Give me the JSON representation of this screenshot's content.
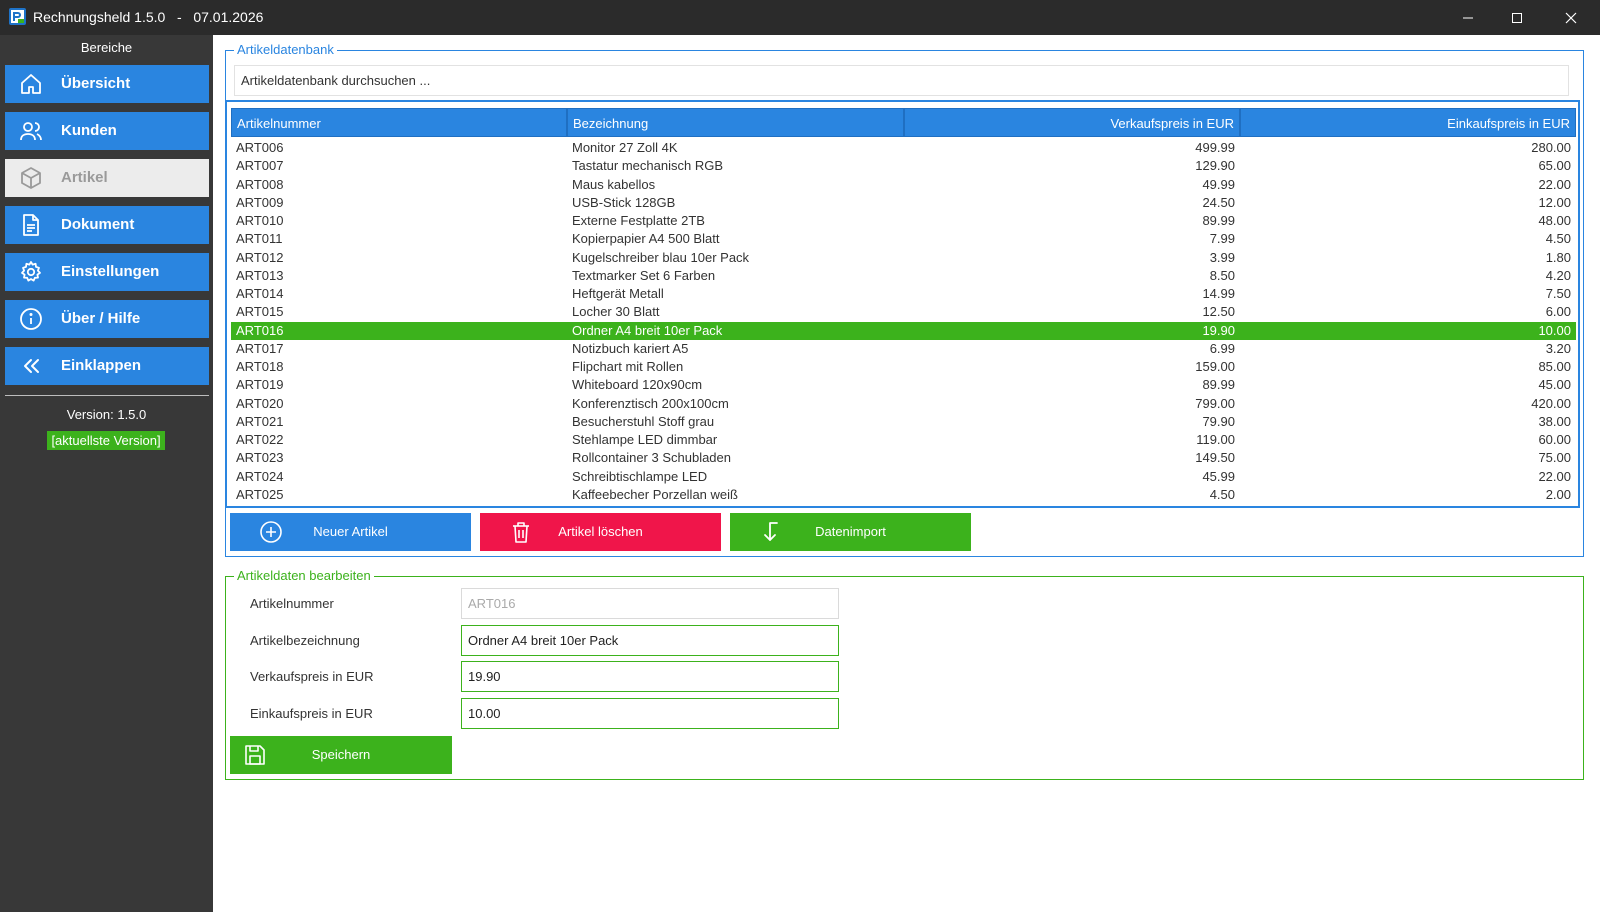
{
  "window": {
    "title": "Rechnungsheld 1.5.0   -   07.01.2026"
  },
  "sidebar": {
    "section_title": "Bereiche",
    "items": [
      {
        "label": "Übersicht",
        "icon": "home-icon"
      },
      {
        "label": "Kunden",
        "icon": "users-icon"
      },
      {
        "label": "Artikel",
        "icon": "box-icon",
        "active": true
      },
      {
        "label": "Dokument",
        "icon": "document-icon"
      },
      {
        "label": "Einstellungen",
        "icon": "gear-icon"
      },
      {
        "label": "Über / Hilfe",
        "icon": "info-icon"
      },
      {
        "label": "Einklappen",
        "icon": "double-chevron-left-icon"
      }
    ],
    "version": "Version: 1.5.0",
    "version_badge": "[aktuellste Version]"
  },
  "article_db": {
    "legend": "Artikeldatenbank",
    "search_placeholder": "Artikeldatenbank durchsuchen ...",
    "columns": [
      "Artikelnummer",
      "Bezeichnung",
      "Verkaufspreis in EUR",
      "Einkaufspreis in EUR"
    ],
    "rows": [
      [
        "ART006",
        "Monitor 27 Zoll 4K",
        "499.99",
        "280.00"
      ],
      [
        "ART007",
        "Tastatur mechanisch RGB",
        "129.90",
        "65.00"
      ],
      [
        "ART008",
        "Maus kabellos",
        "49.99",
        "22.00"
      ],
      [
        "ART009",
        "USB-Stick 128GB",
        "24.50",
        "12.00"
      ],
      [
        "ART010",
        "Externe Festplatte 2TB",
        "89.99",
        "48.00"
      ],
      [
        "ART011",
        "Kopierpapier A4 500 Blatt",
        "7.99",
        "4.50"
      ],
      [
        "ART012",
        "Kugelschreiber blau 10er Pack",
        "3.99",
        "1.80"
      ],
      [
        "ART013",
        "Textmarker Set 6 Farben",
        "8.50",
        "4.20"
      ],
      [
        "ART014",
        "Heftgerät Metall",
        "14.99",
        "7.50"
      ],
      [
        "ART015",
        "Locher 30 Blatt",
        "12.50",
        "6.00"
      ],
      [
        "ART016",
        "Ordner A4 breit 10er Pack",
        "19.90",
        "10.00"
      ],
      [
        "ART017",
        "Notizbuch kariert A5",
        "6.99",
        "3.20"
      ],
      [
        "ART018",
        "Flipchart mit Rollen",
        "159.00",
        "85.00"
      ],
      [
        "ART019",
        "Whiteboard 120x90cm",
        "89.99",
        "45.00"
      ],
      [
        "ART020",
        "Konferenztisch 200x100cm",
        "799.00",
        "420.00"
      ],
      [
        "ART021",
        "Besucherstuhl Stoff grau",
        "79.90",
        "38.00"
      ],
      [
        "ART022",
        "Stehlampe LED dimmbar",
        "119.00",
        "60.00"
      ],
      [
        "ART023",
        "Rollcontainer 3 Schubladen",
        "149.50",
        "75.00"
      ],
      [
        "ART024",
        "Schreibtischlampe LED",
        "45.99",
        "22.00"
      ],
      [
        "ART025",
        "Kaffeebecher Porzellan weiß",
        "4.50",
        "2.00"
      ]
    ],
    "selected_row": 10,
    "buttons": {
      "new": "Neuer Artikel",
      "delete": "Artikel löschen",
      "import": "Datenimport"
    }
  },
  "edit_form": {
    "legend": "Artikeldaten bearbeiten",
    "fields": [
      {
        "label": "Artikelnummer",
        "value": "ART016",
        "disabled": true
      },
      {
        "label": "Artikelbezeichnung",
        "value": "Ordner A4 breit 10er Pack"
      },
      {
        "label": "Verkaufspreis in EUR",
        "value": "19.90"
      },
      {
        "label": "Einkaufspreis in EUR",
        "value": "10.00"
      }
    ],
    "save_label": "Speichern"
  },
  "colors": {
    "accent_blue": "#2a85e0",
    "accent_green": "#3cb21c",
    "danger_red": "#f0154a",
    "sidebar_bg": "#383838",
    "titlebar_bg": "#2b2b2b"
  }
}
